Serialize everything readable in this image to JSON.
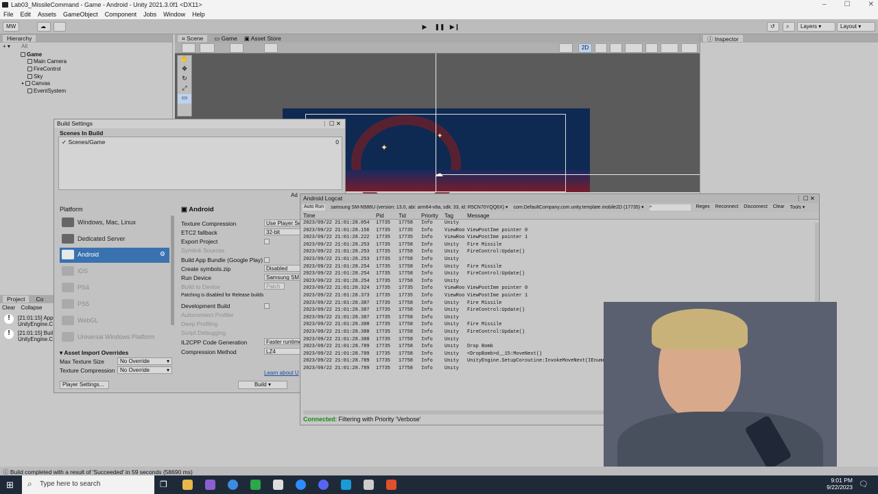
{
  "window": {
    "title": "Lab03_MissileCommand - Game - Android - Unity 2021.3.0f1 <DX11>"
  },
  "menu": [
    "File",
    "Edit",
    "Assets",
    "GameObject",
    "Component",
    "Jobs",
    "Window",
    "Help"
  ],
  "toolbar": {
    "account": "MW",
    "layers": "Layers",
    "layout": "Layout"
  },
  "hierarchy": {
    "tab": "Hierarchy",
    "search": "All",
    "items": [
      "Game",
      "Main Camera",
      "FireControl",
      "Sky",
      "Canvas",
      "EventSystem"
    ]
  },
  "scene_tabs": [
    "Scene",
    "Game",
    "Asset Store"
  ],
  "scene": {
    "mode2d": "2D"
  },
  "inspector": {
    "tab": "Inspector"
  },
  "project": {
    "tabs": [
      "Project",
      "Co"
    ],
    "clear": "Clear",
    "collapse": "Collapse",
    "logs": [
      {
        "time": "[21:01:15] App",
        "src": "UnityEngine.C"
      },
      {
        "time": "[21:01:15] Buil",
        "src": "UnityEngine.C"
      }
    ]
  },
  "build": {
    "title": "Build Settings",
    "scenes_header": "Scenes In Build",
    "scene": "✓ Scenes/Game",
    "scene_index": "0",
    "add_open": "Ad",
    "platform_header": "Platform",
    "platforms": [
      "Windows, Mac, Linux",
      "Dedicated Server",
      "Android",
      "iOS",
      "PS4",
      "PS5",
      "WebGL",
      "Universal Windows Platform"
    ],
    "selected_title": "Android",
    "settings": [
      {
        "label": "Texture Compression",
        "value": "Use Player Se"
      },
      {
        "label": "ETC2 fallback",
        "value": "32-bit"
      },
      {
        "label": "Export Project"
      },
      {
        "label": "Symlink Sources"
      },
      {
        "label": "Build App Bundle (Google Play)"
      },
      {
        "label": "Create symbols.zip",
        "value": "Disabled"
      },
      {
        "label": "Run Device",
        "value": "Samsung SM"
      },
      {
        "label": "Build to Device",
        "value": "Patch"
      },
      {
        "label": "Patching is disabled for Release builds"
      },
      {
        "label": "Development Build"
      },
      {
        "label": "Autoconnect Profiler"
      },
      {
        "label": "Deep Profiling"
      },
      {
        "label": "Script Debugging"
      },
      {
        "label": "IL2CPP Code Generation",
        "value": "Faster runtime"
      },
      {
        "label": "Compression Method",
        "value": "LZ4"
      }
    ],
    "learn_more": "Learn about U",
    "asset_overrides": "Asset Import Overrides",
    "max_texture_label": "Max Texture Size",
    "max_texture_value": "No Override",
    "tex_comp_label": "Texture Compression",
    "tex_comp_value": "No Override",
    "player_settings": "Player Settings...",
    "build_btn": "Build"
  },
  "logcat": {
    "title": "Android Logcat",
    "auto_run": "Auto Run",
    "device": "samsung SM-N986U (version: 13.0, abi: arm64-v8a, sdk: 33, id: R5CN70YQQ6X)",
    "package": "com.DefaultCompany.com.unity.template.mobile2D (17735)",
    "actions": [
      "Regex",
      "Reconnect",
      "Disconnect",
      "Clear",
      "Tools"
    ],
    "columns": [
      "Time",
      "Pid",
      "Tid",
      "Priority",
      "Tag",
      "Message"
    ],
    "rows": [
      [
        "2023/09/22 21:01:28.054",
        "17735",
        "17758",
        "Info",
        "Unity",
        ""
      ],
      [
        "2023/09/22 21:01:28.156",
        "17735",
        "17735",
        "Info",
        "ViewRoot",
        "ViewPostIme pointer 0"
      ],
      [
        "2023/09/22 21:01:28.222",
        "17735",
        "17735",
        "Info",
        "ViewRoot",
        "ViewPostIme pointer 1"
      ],
      [
        "2023/09/22 21:01:28.253",
        "17735",
        "17758",
        "Info",
        "Unity",
        "Fire Missile"
      ],
      [
        "2023/09/22 21:01:28.253",
        "17735",
        "17758",
        "Info",
        "Unity",
        "FireControl:Update()"
      ],
      [
        "2023/09/22 21:01:28.253",
        "17735",
        "17758",
        "Info",
        "Unity",
        ""
      ],
      [
        "2023/09/22 21:01:28.254",
        "17735",
        "17758",
        "Info",
        "Unity",
        "Fire Missile"
      ],
      [
        "2023/09/22 21:01:28.254",
        "17735",
        "17758",
        "Info",
        "Unity",
        "FireControl:Update()"
      ],
      [
        "2023/09/22 21:01:28.254",
        "17735",
        "17758",
        "Info",
        "Unity",
        ""
      ],
      [
        "2023/09/22 21:01:28.324",
        "17735",
        "17735",
        "Info",
        "ViewRoot",
        "ViewPostIme pointer 0"
      ],
      [
        "2023/09/22 21:01:28.373",
        "17735",
        "17735",
        "Info",
        "ViewRoot",
        "ViewPostIme pointer 1"
      ],
      [
        "2023/09/22 21:01:28.387",
        "17735",
        "17758",
        "Info",
        "Unity",
        "Fire Missile"
      ],
      [
        "2023/09/22 21:01:28.387",
        "17735",
        "17758",
        "Info",
        "Unity",
        "FireControl:Update()"
      ],
      [
        "2023/09/22 21:01:28.387",
        "17735",
        "17758",
        "Info",
        "Unity",
        ""
      ],
      [
        "2023/09/22 21:01:28.388",
        "17735",
        "17758",
        "Info",
        "Unity",
        "Fire Missile"
      ],
      [
        "2023/09/22 21:01:28.388",
        "17735",
        "17758",
        "Info",
        "Unity",
        "FireControl:Update()"
      ],
      [
        "2023/09/22 21:01:28.388",
        "17735",
        "17758",
        "Info",
        "Unity",
        ""
      ],
      [
        "2023/09/22 21:01:28.789",
        "17735",
        "17758",
        "Info",
        "Unity",
        "Drop Bomb"
      ],
      [
        "2023/09/22 21:01:28.789",
        "17735",
        "17758",
        "Info",
        "Unity",
        "<DropBomb>d__15:MoveNext()"
      ],
      [
        "2023/09/22 21:01:28.789",
        "17735",
        "17758",
        "Info",
        "Unity",
        "UnityEngine.SetupCoroutine:InvokeMoveNext(IEnumerator, IntPtr)"
      ],
      [
        "2023/09/22 21:01:28.789",
        "17735",
        "17758",
        "Info",
        "Unity",
        ""
      ]
    ],
    "status_connected": "Connected",
    "status_text": ": Filtering with Priority 'Verbose'"
  },
  "status_bar": "Build completed with a result of 'Succeeded' in 59 seconds (58690 ms)",
  "taskbar": {
    "search_placeholder": "Type here to search",
    "time": "9:01 PM",
    "date": "9/22/2023"
  },
  "colors": {
    "accent": "#3a72b0",
    "connected": "#1a8a1a",
    "scene_sky": "#0f2a52"
  }
}
